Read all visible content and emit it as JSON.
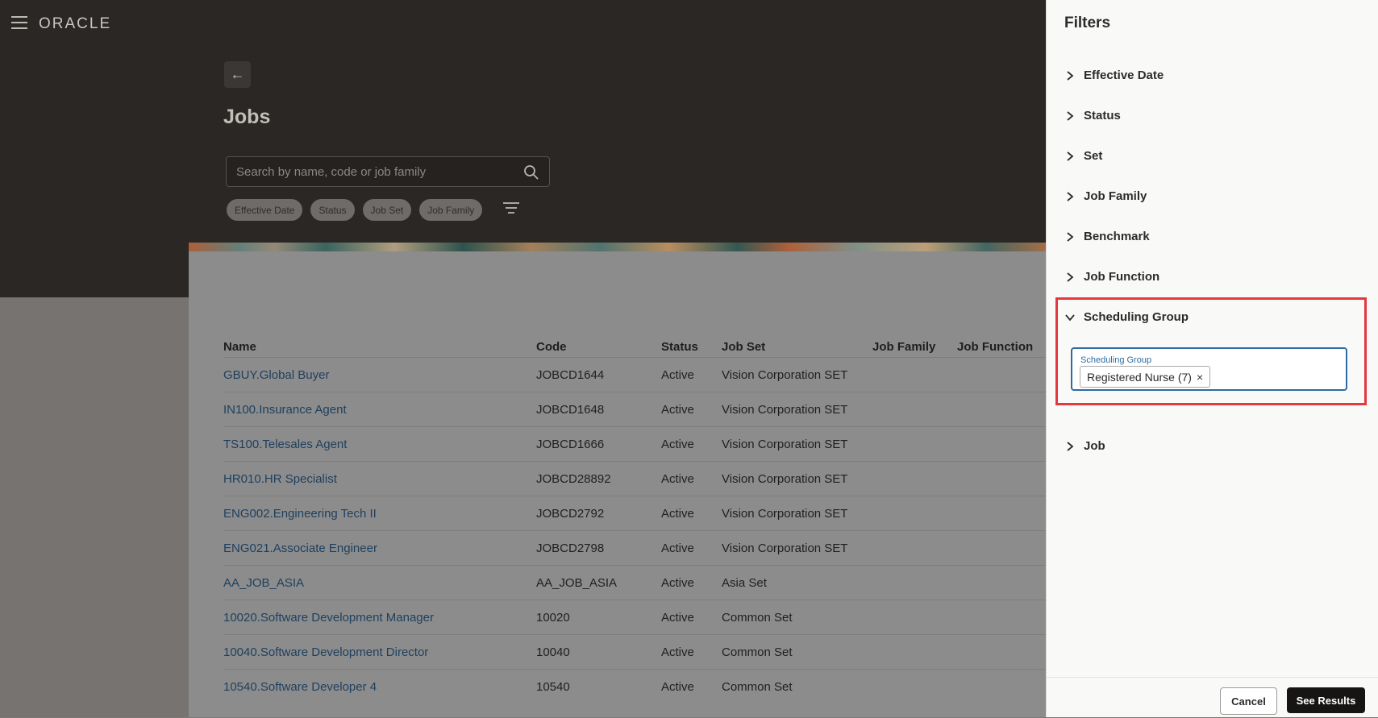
{
  "app": {
    "logo": "ORACLE"
  },
  "page": {
    "back_glyph": "←",
    "title": "Jobs",
    "search_placeholder": "Search by name, code or job family",
    "chips": [
      "Effective Date",
      "Status",
      "Job Set",
      "Job Family"
    ]
  },
  "table": {
    "headers": [
      "Name",
      "Code",
      "Status",
      "Job Set",
      "Job Family",
      "Job Function"
    ],
    "rows": [
      [
        "GBUY.Global Buyer",
        "JOBCD1644",
        "Active",
        "Vision Corporation SET"
      ],
      [
        "IN100.Insurance Agent",
        "JOBCD1648",
        "Active",
        "Vision Corporation SET"
      ],
      [
        "TS100.Telesales Agent",
        "JOBCD1666",
        "Active",
        "Vision Corporation SET"
      ],
      [
        "HR010.HR Specialist",
        "JOBCD28892",
        "Active",
        "Vision Corporation SET"
      ],
      [
        "ENG002.Engineering Tech II",
        "JOBCD2792",
        "Active",
        "Vision Corporation SET"
      ],
      [
        "ENG021.Associate Engineer",
        "JOBCD2798",
        "Active",
        "Vision Corporation SET"
      ],
      [
        "AA_JOB_ASIA",
        "AA_JOB_ASIA",
        "Active",
        "Asia Set"
      ],
      [
        "10020.Software Development Manager",
        "10020",
        "Active",
        "Common Set"
      ],
      [
        "10040.Software Development Director",
        "10040",
        "Active",
        "Common Set"
      ],
      [
        "10540.Software Developer 4",
        "10540",
        "Active",
        "Common Set"
      ]
    ]
  },
  "filters": {
    "title": "Filters",
    "sections": [
      "Effective Date",
      "Status",
      "Set",
      "Job Family",
      "Benchmark",
      "Job Function",
      "Scheduling Group",
      "Job"
    ],
    "scheduling_group": {
      "field_label": "Scheduling Group",
      "selected": "Registered Nurse (7)",
      "remove_glyph": "×"
    },
    "cancel_label": "Cancel",
    "see_results_label": "See Results"
  }
}
